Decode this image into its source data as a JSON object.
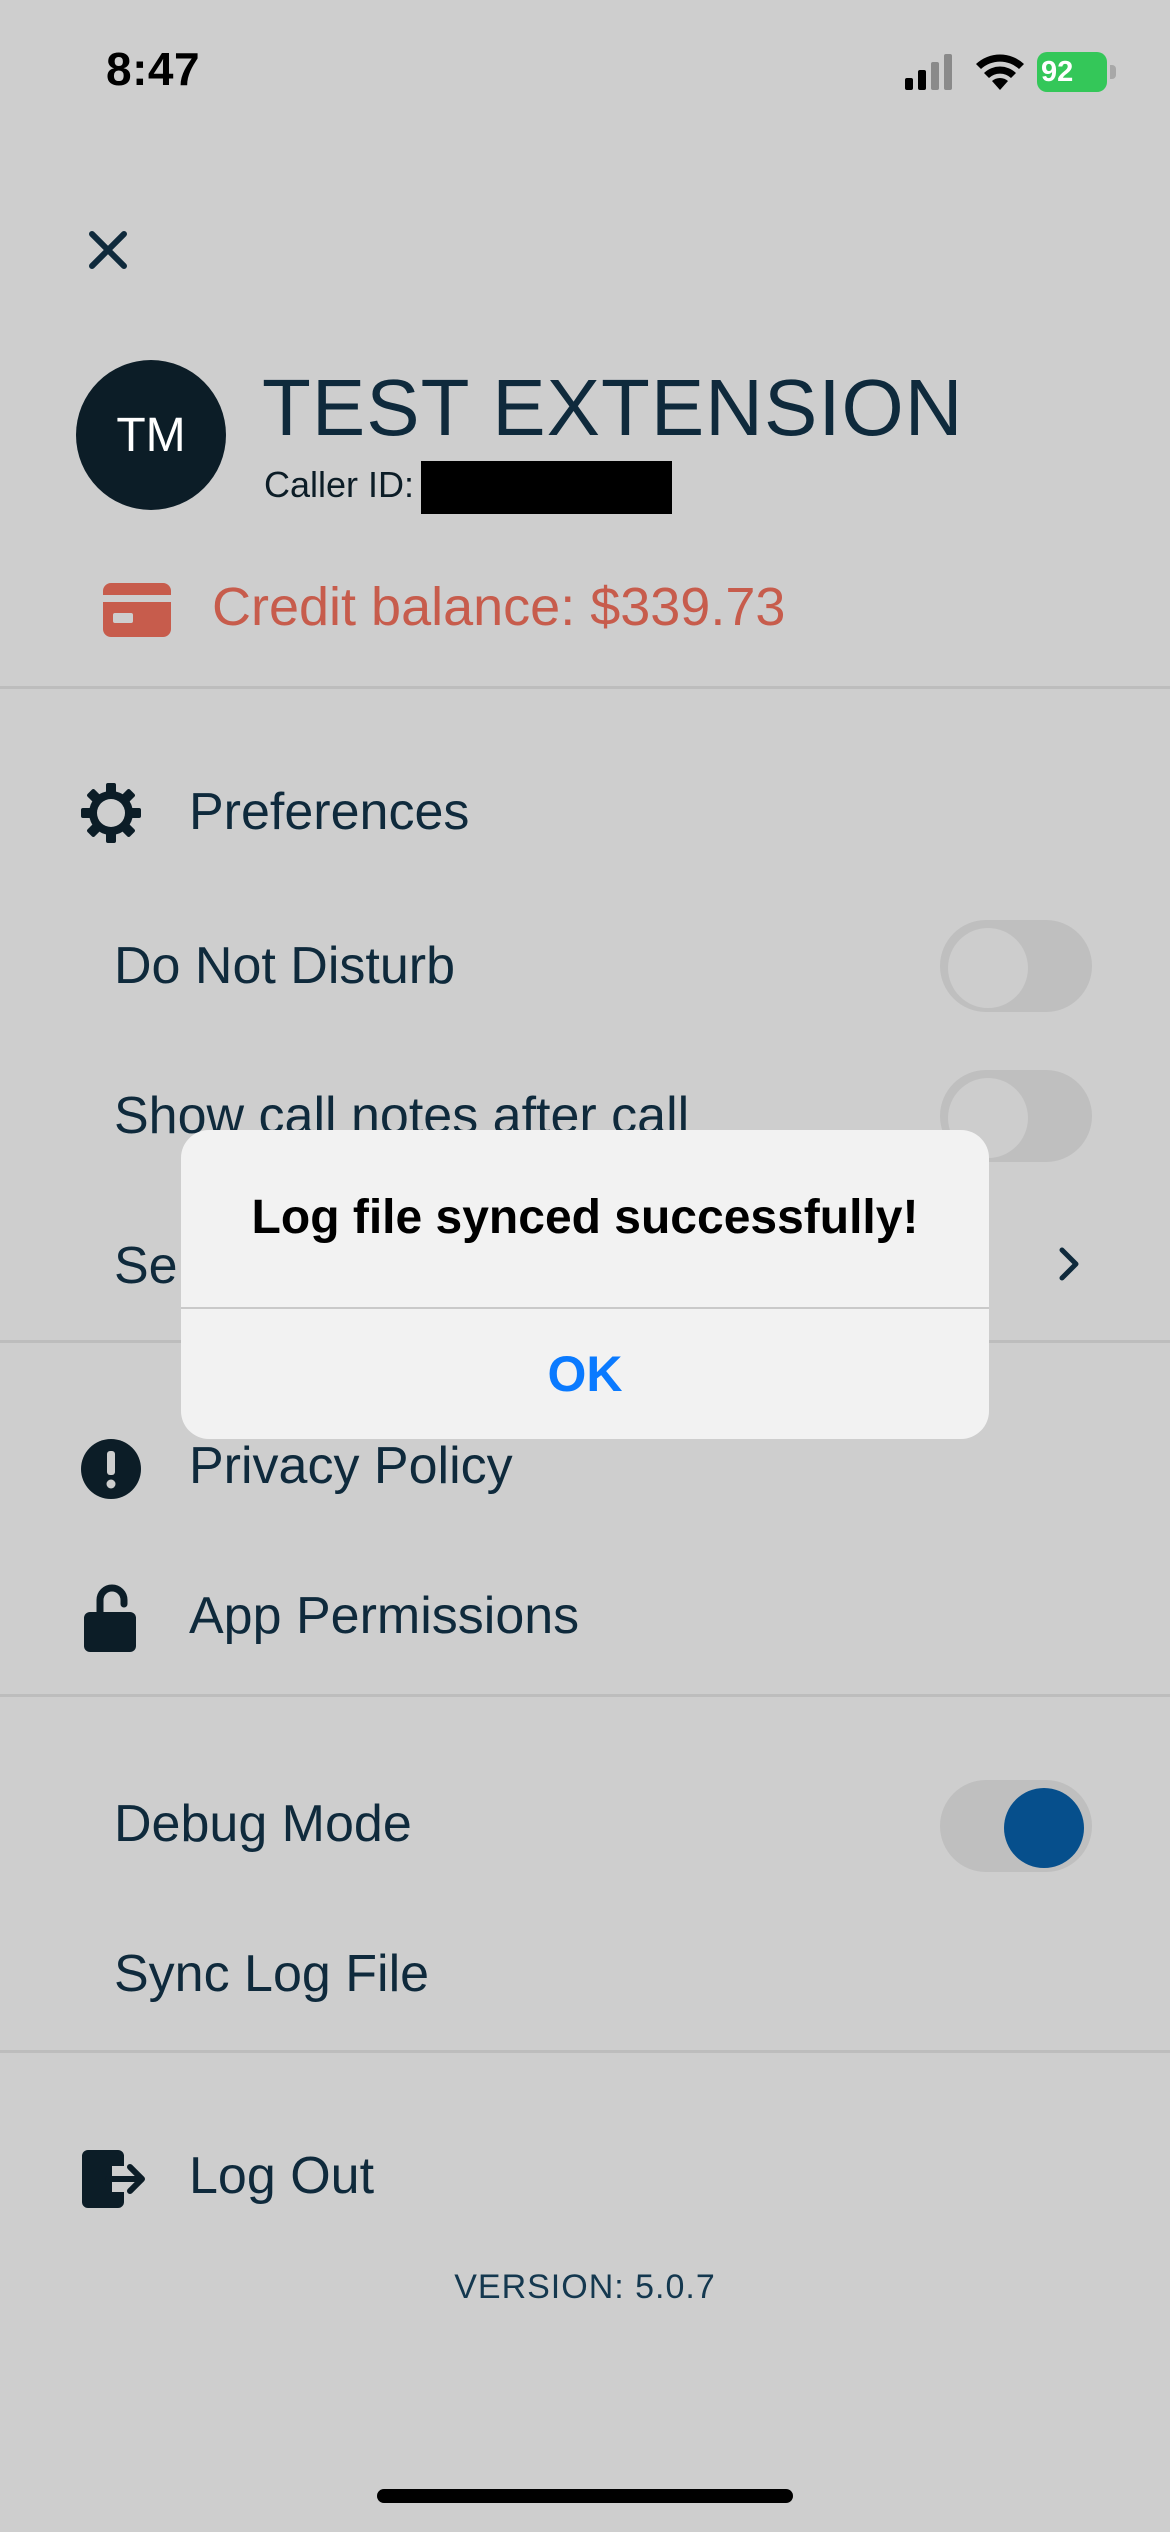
{
  "status_bar": {
    "time": "8:47",
    "battery": "92"
  },
  "profile": {
    "initials": "TM",
    "name": "TEST EXTENSION",
    "caller_id_label": "Caller ID:",
    "credit": "Credit balance: $339.73"
  },
  "menu": {
    "preferences": "Preferences",
    "do_not_disturb": "Do Not Disturb",
    "show_call_notes": "Show call notes after call",
    "select_partial": "Sel",
    "privacy_policy": "Privacy Policy",
    "app_permissions": "App Permissions",
    "debug_mode": "Debug Mode",
    "sync_log_file": "Sync Log File",
    "log_out": "Log Out"
  },
  "toggles": {
    "do_not_disturb": false,
    "show_call_notes": false,
    "debug_mode": true
  },
  "version": "VERSION: 5.0.7",
  "alert": {
    "title": "Log file synced successfully!",
    "ok": "OK"
  },
  "colors": {
    "accent": "#064f8c",
    "credit": "#c75c4c",
    "alert_button": "#0a7aff"
  }
}
